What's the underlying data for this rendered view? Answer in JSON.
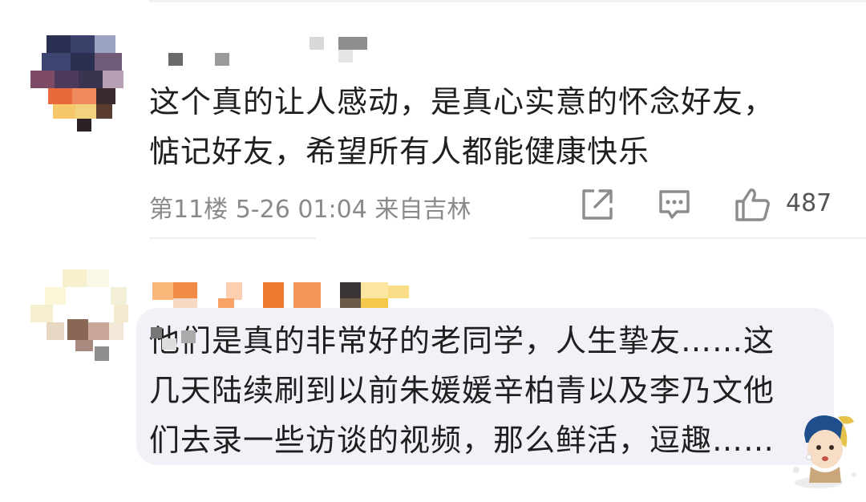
{
  "comments": [
    {
      "lines": [
        "这个真的让人感动，是真心实意的怀念好友，",
        "惦记好友，希望所有人都能健康快乐"
      ],
      "meta": "第11楼 5-26 01:04 来自吉林",
      "like_count": "487",
      "icons": [
        "share-icon",
        "reply-icon",
        "like-icon"
      ]
    },
    {
      "lines": [
        "他们是真的非常好的老同学，人生挚友……这",
        "几天陆续刷到以前朱媛媛辛柏青以及李乃文他",
        "们去录一些访谈的视频，那么鲜活，逗趣……"
      ],
      "sticker": "girl-with-pearl-earring-sticker"
    }
  ],
  "colors": {
    "meta_text": "#8a8a8a",
    "icon_stroke": "#8c8c8c",
    "bubble_bg": "#f4f0f7"
  }
}
